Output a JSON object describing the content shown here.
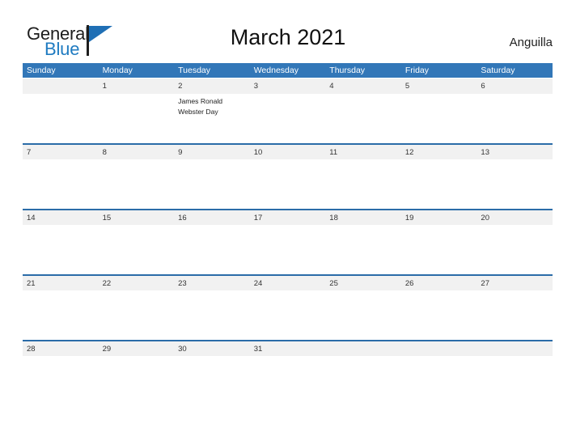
{
  "brand": {
    "name_part1": "General",
    "name_part2": "Blue",
    "triangle_color": "#1f6fb5",
    "blue_text_color": "#1f7bc1"
  },
  "header": {
    "title": "March 2021",
    "region": "Anguilla"
  },
  "calendar": {
    "header_bg": "#3277b8",
    "strip_bg": "#f1f1f1",
    "strip_border": "#2b6ca8",
    "weekdays": [
      "Sunday",
      "Monday",
      "Tuesday",
      "Wednesday",
      "Thursday",
      "Friday",
      "Saturday"
    ],
    "weeks": [
      {
        "days": [
          {
            "number": "",
            "events": []
          },
          {
            "number": "1",
            "events": []
          },
          {
            "number": "2",
            "events": [
              "James Ronald Webster Day"
            ]
          },
          {
            "number": "3",
            "events": []
          },
          {
            "number": "4",
            "events": []
          },
          {
            "number": "5",
            "events": []
          },
          {
            "number": "6",
            "events": []
          }
        ]
      },
      {
        "days": [
          {
            "number": "7",
            "events": []
          },
          {
            "number": "8",
            "events": []
          },
          {
            "number": "9",
            "events": []
          },
          {
            "number": "10",
            "events": []
          },
          {
            "number": "11",
            "events": []
          },
          {
            "number": "12",
            "events": []
          },
          {
            "number": "13",
            "events": []
          }
        ]
      },
      {
        "days": [
          {
            "number": "14",
            "events": []
          },
          {
            "number": "15",
            "events": []
          },
          {
            "number": "16",
            "events": []
          },
          {
            "number": "17",
            "events": []
          },
          {
            "number": "18",
            "events": []
          },
          {
            "number": "19",
            "events": []
          },
          {
            "number": "20",
            "events": []
          }
        ]
      },
      {
        "days": [
          {
            "number": "21",
            "events": []
          },
          {
            "number": "22",
            "events": []
          },
          {
            "number": "23",
            "events": []
          },
          {
            "number": "24",
            "events": []
          },
          {
            "number": "25",
            "events": []
          },
          {
            "number": "26",
            "events": []
          },
          {
            "number": "27",
            "events": []
          }
        ]
      },
      {
        "days": [
          {
            "number": "28",
            "events": []
          },
          {
            "number": "29",
            "events": []
          },
          {
            "number": "30",
            "events": []
          },
          {
            "number": "31",
            "events": []
          },
          {
            "number": "",
            "events": []
          },
          {
            "number": "",
            "events": []
          },
          {
            "number": "",
            "events": []
          }
        ]
      }
    ]
  }
}
